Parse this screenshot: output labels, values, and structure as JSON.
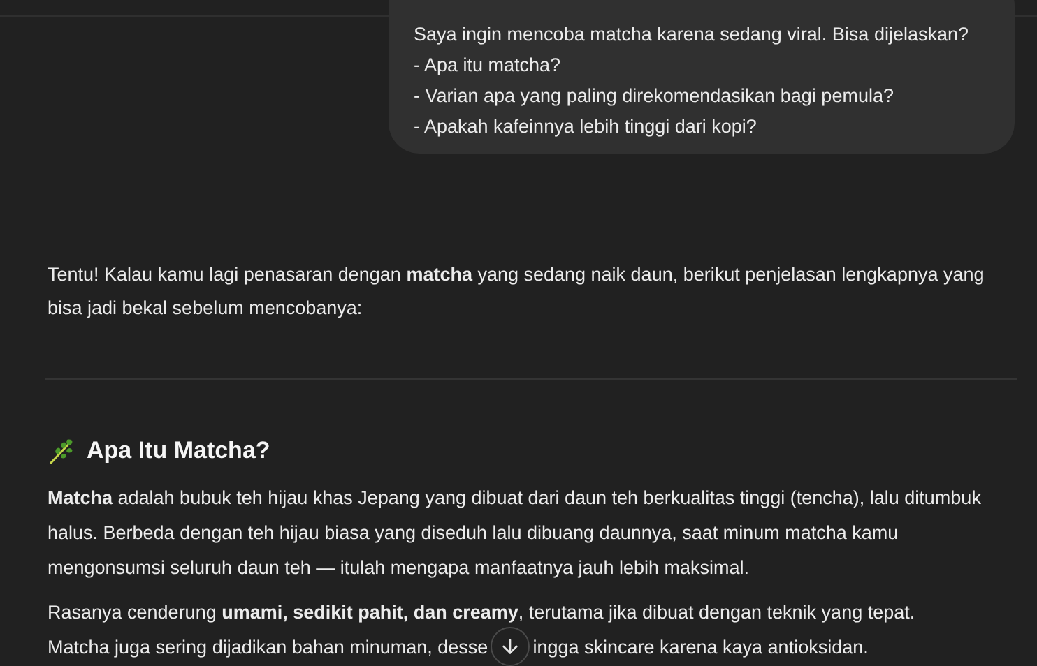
{
  "user_message": {
    "lines": [
      "Saya ingin mencoba matcha karena sedang viral. Bisa dijelaskan?",
      "- Apa itu matcha?",
      "- Varian apa yang paling direkomendasikan bagi pemula?",
      "- Apakah kafeinnya lebih tinggi dari kopi?"
    ]
  },
  "reply": {
    "intro": "Tentu! Kalau kamu lagi penasaran dengan **matcha** yang sedang naik daun, berikut penjelasan lengkapnya yang bisa jadi bekal sebelum mencobanya:",
    "heading": "Apa Itu Matcha?",
    "paragraphs": [
      "**Matcha** adalah bubuk teh hijau khas Jepang yang dibuat dari daun teh berkualitas tinggi (tencha), lalu ditumbuk halus. Berbeda dengan teh hijau biasa yang diseduh lalu dibuang daunnya, saat minum matcha kamu mengonsumsi seluruh daun teh — itulah mengapa manfaatnya jauh lebih maksimal."
    ],
    "last_paragraph": {
      "first_line": "Rasanya cenderung **umami, sedikit pahit, dan creamy**, terutama jika dibuat dengan teknik yang tepat.",
      "before_button": "Matcha juga sering dijadikan bahan minuman, desse",
      "after_button": "ingga skincare karena kaya antioksidan."
    }
  }
}
